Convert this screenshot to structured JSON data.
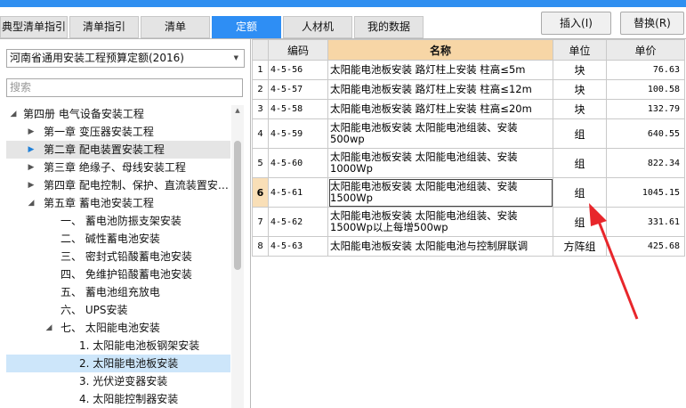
{
  "colors": {
    "accent": "#2e8ef4",
    "selected_row": "#cde6fa",
    "name_header": "#f7d6a6",
    "annotation_arrow": "#e8262b"
  },
  "tabs": [
    {
      "label": "典型清单指引",
      "active": false
    },
    {
      "label": "清单指引",
      "active": false
    },
    {
      "label": "清单",
      "active": false
    },
    {
      "label": "定额",
      "active": true
    },
    {
      "label": "人材机",
      "active": false
    },
    {
      "label": "我的数据",
      "active": false
    }
  ],
  "toolbar": {
    "insert_label": "插入(I)",
    "replace_label": "替换(R)"
  },
  "library_select": {
    "value": "河南省通用安装工程预算定额(2016)",
    "dropdown_icon": "triangle-down-icon"
  },
  "search": {
    "placeholder": "搜索"
  },
  "tree": [
    {
      "label": "第四册  电气设备安装工程",
      "expander": "expanded"
    },
    {
      "label": "第一章  变压器安装工程",
      "expander": "collapsed"
    },
    {
      "label": "第二章  配电装置安装工程",
      "expander": "collapsed-active",
      "state": "hover"
    },
    {
      "label": "第三章  绝缘子、母线安装工程",
      "expander": "collapsed"
    },
    {
      "label": "第四章  配电控制、保护、直流装置安…",
      "expander": "collapsed"
    },
    {
      "label": "第五章  蓄电池安装工程",
      "expander": "expanded"
    },
    {
      "label": "一、  蓄电池防振支架安装",
      "expander": "none"
    },
    {
      "label": "二、  碱性蓄电池安装",
      "expander": "none"
    },
    {
      "label": "三、  密封式铅酸蓄电池安装",
      "expander": "none"
    },
    {
      "label": "四、  免维护铅酸蓄电池安装",
      "expander": "none"
    },
    {
      "label": "五、  蓄电池组充放电",
      "expander": "none"
    },
    {
      "label": "六、  UPS安装",
      "expander": "none"
    },
    {
      "label": "七、  太阳能电池安装",
      "expander": "expanded"
    },
    {
      "label": "1. 太阳能电池板钢架安装",
      "expander": "none"
    },
    {
      "label": "2. 太阳能电池板安装",
      "expander": "none",
      "state": "selected"
    },
    {
      "label": "3. 光伏逆变器安装",
      "expander": "none"
    },
    {
      "label": "4. 太阳能控制器安装",
      "expander": "none"
    }
  ],
  "table": {
    "headers": {
      "code": "编码",
      "name": "名称",
      "unit": "单位",
      "price": "单价"
    },
    "rows": [
      {
        "idx": "1",
        "code": "4-5-56",
        "name": "太阳能电池板安装 路灯柱上安装 柱高≤5m",
        "unit": "块",
        "price": "76.63"
      },
      {
        "idx": "2",
        "code": "4-5-57",
        "name": "太阳能电池板安装 路灯柱上安装 柱高≤12m",
        "unit": "块",
        "price": "100.58"
      },
      {
        "idx": "3",
        "code": "4-5-58",
        "name": "太阳能电池板安装 路灯柱上安装 柱高≤20m",
        "unit": "块",
        "price": "132.79"
      },
      {
        "idx": "4",
        "code": "4-5-59",
        "name": "太阳能电池板安装 太阳能电池组装、安装 500wp",
        "unit": "组",
        "price": "640.55"
      },
      {
        "idx": "5",
        "code": "4-5-60",
        "name": "太阳能电池板安装 太阳能电池组装、安装 1000Wp",
        "unit": "组",
        "price": "822.34"
      },
      {
        "idx": "6",
        "code": "4-5-61",
        "name": "太阳能电池板安装 太阳能电池组装、安装 1500Wp",
        "unit": "组",
        "price": "1045.15",
        "current": true
      },
      {
        "idx": "7",
        "code": "4-5-62",
        "name": "太阳能电池板安装 太阳能电池组装、安装 1500Wp以上每增500wp",
        "unit": "组",
        "price": "331.61"
      },
      {
        "idx": "8",
        "code": "4-5-63",
        "name": "太阳能电池板安装 太阳能电池与控制屏联调",
        "unit": "方阵组",
        "price": "425.68"
      }
    ]
  }
}
